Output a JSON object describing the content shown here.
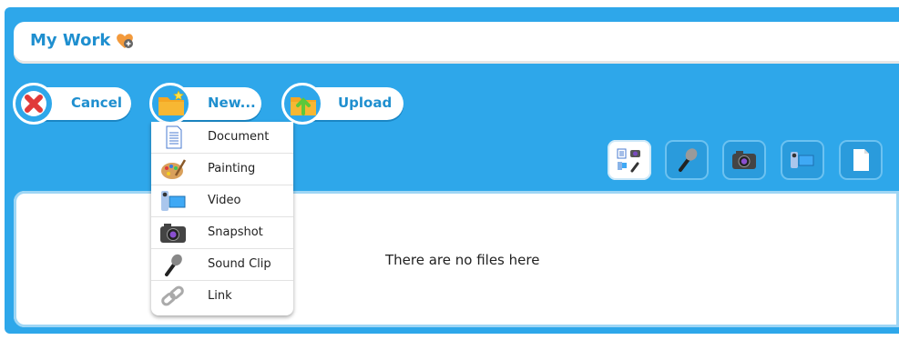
{
  "header": {
    "title": "My Work",
    "icon": "heart-add-icon"
  },
  "toolbar": {
    "cancel_label": "Cancel",
    "new_label": "New...",
    "upload_label": "Upload"
  },
  "new_menu": {
    "items": [
      {
        "label": "Document",
        "icon": "document-icon"
      },
      {
        "label": "Painting",
        "icon": "palette-icon"
      },
      {
        "label": "Video",
        "icon": "video-camera-icon"
      },
      {
        "label": "Snapshot",
        "icon": "camera-icon"
      },
      {
        "label": "Sound Clip",
        "icon": "microphone-icon"
      },
      {
        "label": "Link",
        "icon": "link-icon"
      }
    ]
  },
  "filters": [
    {
      "icon": "all-types-icon",
      "active": true
    },
    {
      "icon": "microphone-icon",
      "active": false
    },
    {
      "icon": "camera-icon",
      "active": false
    },
    {
      "icon": "video-camera-icon",
      "active": false
    },
    {
      "icon": "document-icon",
      "active": false
    }
  ],
  "files": {
    "empty_message": "There are no files here"
  },
  "colors": {
    "background": "#2ea7ea",
    "accent_text": "#1f8fcf",
    "cancel_red": "#e03a3a",
    "folder_orange": "#f5a623"
  }
}
